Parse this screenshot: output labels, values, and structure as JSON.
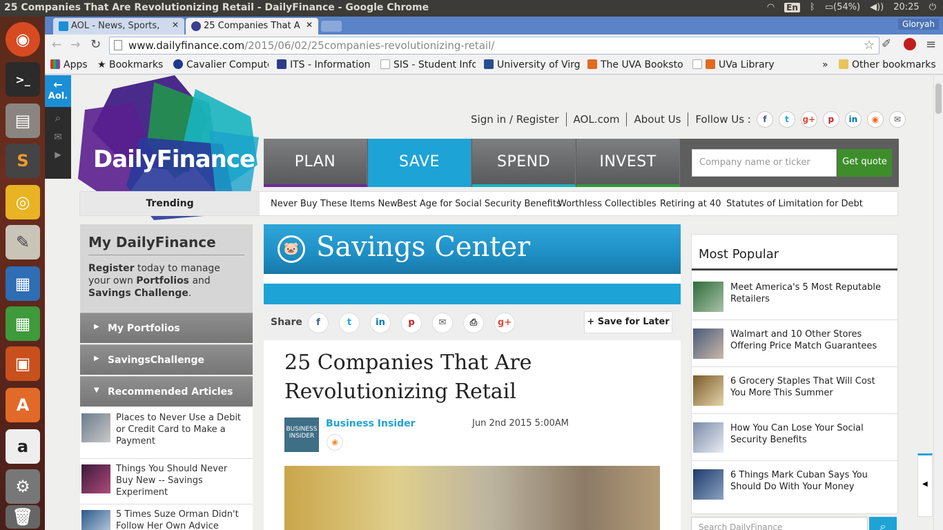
{
  "os": {
    "window_title": "25 Companies That Are Revolutionizing Retail - DailyFinance - Google Chrome",
    "lang": "En",
    "battery": "(54%)",
    "time": "20:25",
    "user": "Gloryah"
  },
  "tabs": [
    {
      "label": "AOL - News, Sports,",
      "active": false
    },
    {
      "label": "25 Companies That A",
      "active": true
    }
  ],
  "url": {
    "domain": "www.dailyfinance.com",
    "path": "/2015/06/02/25companies-revolutionizing-retail/"
  },
  "bookmarks": {
    "apps": "Apps",
    "bookmarks": "Bookmarks",
    "items": [
      "Cavalier Compute",
      "ITS - Information",
      "SIS - Student Info",
      "University of Virg",
      "The UVA Booksto",
      "UVa Library"
    ],
    "overflow": "»",
    "other": "Other bookmarks"
  },
  "site": {
    "aol_logo": "Aol.",
    "logo": "DailyFinance",
    "topnav": {
      "signin": "Sign in / Register",
      "aol": "AOL.com",
      "about": "About Us",
      "follow": "Follow Us :"
    },
    "nav": [
      "PLAN",
      "SAVE",
      "SPEND",
      "INVEST"
    ],
    "quote_placeholder": "Company name or ticker",
    "quote_button": "Get quote",
    "trending_label": "Trending",
    "trending": [
      "Never Buy These Items New",
      "Best Age for Social Security Benefits",
      "Worthless Collectibles",
      "Retiring at 40",
      "Statutes of Limitation for Debt"
    ]
  },
  "left": {
    "title": "My DailyFinance",
    "promo": {
      "register": "Register",
      "t1": " today to manage your own ",
      "portfolios": "Portfolios",
      "t2": " and ",
      "savings": "Savings Challenge",
      "t3": "."
    },
    "menu": [
      "My Portfolios",
      "SavingsChallenge",
      "Recommended Articles"
    ],
    "articles": [
      "Places to Never Use a Debit or Credit Card to Make a Payment",
      "Things You Should Never Buy New -- Savings Experiment",
      "5 Times Suze Orman Didn't Follow Her Own Advice"
    ]
  },
  "main": {
    "section": "Savings Center",
    "share_label": "Share",
    "save_later": "Save for Later",
    "title": "25 Companies That Are Revolutionizing Retail",
    "source_logo": "BUSINESS INSIDER",
    "source": "Business Insider",
    "date": "Jun 2nd 2015 5:00AM"
  },
  "right": {
    "title": "Most Popular",
    "items": [
      "Meet America's 5 Most Reputable Retailers",
      "Walmart and 10 Other Stores Offering Price Match Guarantees",
      "6 Grocery Staples That Will Cost You More This Summer",
      "How You Can Lose Your Social Security Benefits",
      "6 Things Mark Cuban Says You Should Do With Your Money"
    ],
    "search_placeholder": "Search DailyFinance"
  },
  "colors": {
    "accent_blue": "#1ea3d7",
    "quote_green": "#3d8e2a",
    "tab_blue": "#5a83c8"
  }
}
